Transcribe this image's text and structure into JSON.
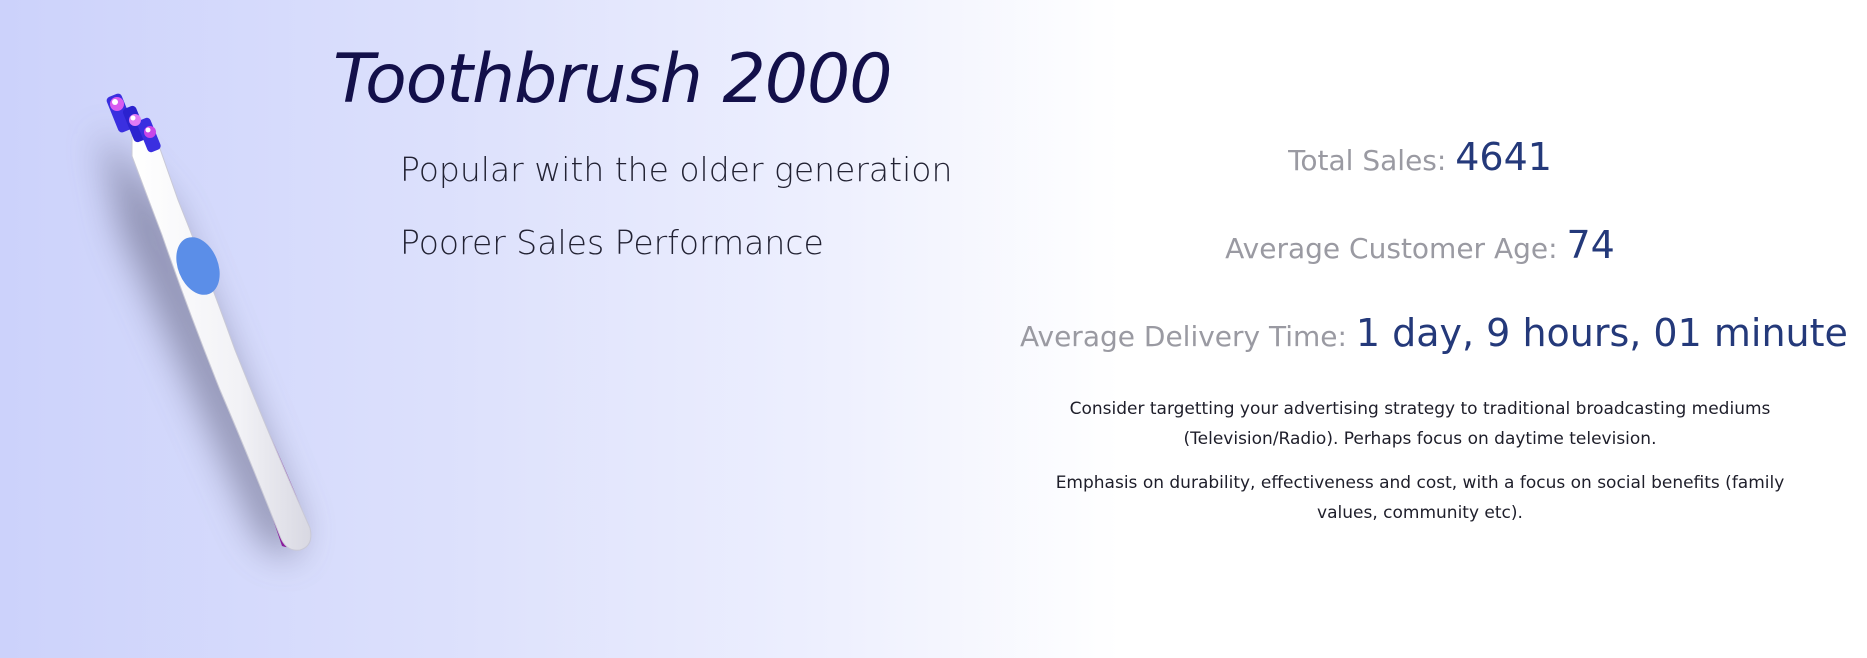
{
  "product": {
    "title": "Toothbrush 2000",
    "tagline": "Popular with the older generation",
    "performance": "Poorer Sales Performance",
    "image_icon": "toothbrush-icon"
  },
  "stats": {
    "total_sales_label": "Total Sales: ",
    "total_sales_value": "4641",
    "avg_age_label": "Average Customer Age: ",
    "avg_age_value": "74",
    "avg_delivery_label": "Average Delivery Time: ",
    "avg_delivery_value": "1 day, 9 hours, 01 minute"
  },
  "advice": {
    "strategy": "Consider targetting your advertising strategy to traditional broadcasting mediums (Television/Radio). Perhaps focus on daytime television.",
    "emphasis": "Emphasis on durability, effectiveness and cost, with a focus on social benefits (family values, community etc)."
  },
  "colors": {
    "title": "#13104a",
    "stat_label": "#9a9aa2",
    "stat_value": "#24397a",
    "handle_accent": "#8a1c9c",
    "grip": "#5b8ee8",
    "bristles": "#3a2fe0"
  }
}
